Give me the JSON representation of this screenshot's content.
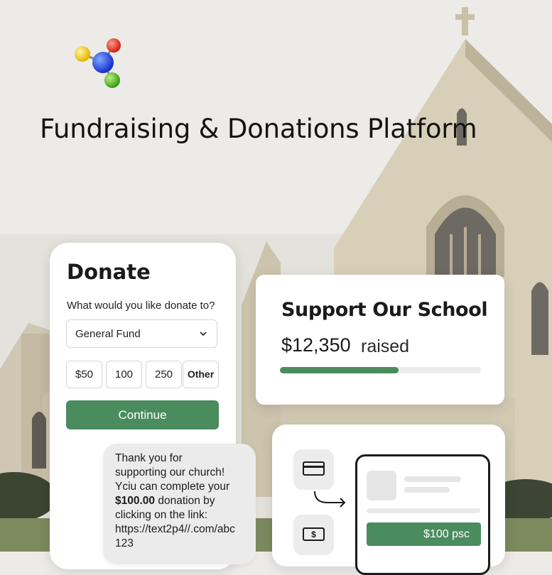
{
  "headline": "Fundraising & Donations Platform",
  "colors": {
    "accent": "#4a8c5e",
    "background": "#ecebe7"
  },
  "logo": {
    "icon": "molecule-logo"
  },
  "donate_card": {
    "title": "Donate",
    "question": "What would you like donate to?",
    "fund_select": {
      "value": "General Fund",
      "icon": "chevron-down-icon"
    },
    "amounts": [
      "$50",
      "100",
      "250",
      "Other"
    ],
    "continue_label": "Continue"
  },
  "support_card": {
    "title": "Support Our School",
    "amount": "$12,350",
    "raised_label": "raised",
    "progress_fraction": 0.59
  },
  "sms": {
    "lines": [
      "Thank you for",
      "supporting our church!",
      "Yciu can complete your",
      "$100.00",
      " donation by",
      "clicking on the link:",
      "https://text2p4//.com/abc",
      "123"
    ]
  },
  "payment_card": {
    "icons": [
      "credit-card-icon",
      "dollar-bill-icon"
    ],
    "button_label": "$100 psc"
  }
}
